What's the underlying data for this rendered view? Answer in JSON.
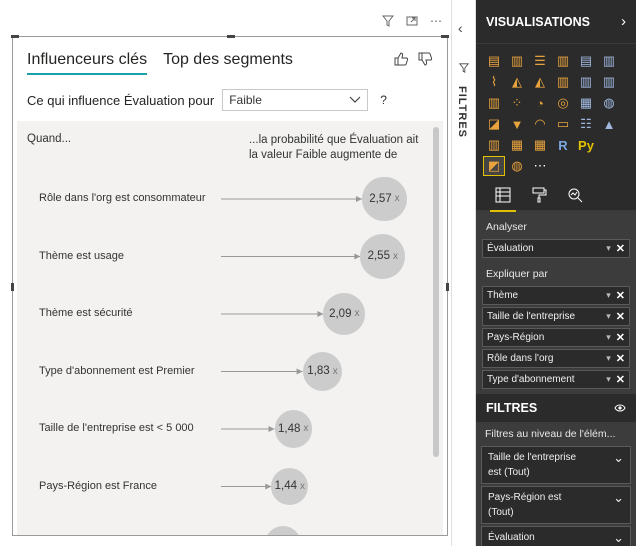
{
  "canvas": {
    "header_icons": [
      "filter-icon",
      "focus-mode-icon",
      "more-options-icon"
    ]
  },
  "visual": {
    "tabs": [
      {
        "label": "Influenceurs clés",
        "active": true
      },
      {
        "label": "Top des segments",
        "active": false
      }
    ],
    "influence_label": "Ce qui influence Évaluation pour",
    "influence_value": "Faible",
    "help": "?",
    "col_left": "Quand...",
    "col_right": "...la probabilité que Évaluation ait la valeur Faible augmente de",
    "accent_color": "#1aa0a6",
    "influencers": [
      {
        "label": "Rôle dans l'org est consommateur",
        "value": "2,57",
        "unit": "x",
        "factor": 2.57
      },
      {
        "label": "Thème est usage",
        "value": "2,55",
        "unit": "x",
        "factor": 2.55
      },
      {
        "label": "Thème est sécurité",
        "value": "2,09",
        "unit": "x",
        "factor": 2.09
      },
      {
        "label": "Type d'abonnement est Premier",
        "value": "1,83",
        "unit": "x",
        "factor": 1.83
      },
      {
        "label": "Taille de l'entreprise est < 5 000",
        "value": "1,48",
        "unit": "x",
        "factor": 1.48
      },
      {
        "label": "Pays-Région est France",
        "value": "1,44",
        "unit": "x",
        "factor": 1.44
      },
      {
        "label": "",
        "value": "",
        "unit": "",
        "factor": 1.36
      }
    ]
  },
  "filters_rail": {
    "label": "FILTRES"
  },
  "vis_pane": {
    "title": "VISUALISATIONS",
    "gallery_icons": [
      "stacked-bar-icon",
      "stacked-column-icon",
      "clustered-bar-icon",
      "clustered-column-icon",
      "100-bar-icon",
      "100-column-icon",
      "line-chart-icon",
      "area-chart-icon",
      "stacked-area-icon",
      "line-column-icon",
      "line-clustered-column-icon",
      "ribbon-chart-icon",
      "waterfall-icon",
      "scatter-icon",
      "pie-chart-icon",
      "donut-chart-icon",
      "treemap-icon",
      "map-icon",
      "filled-map-icon",
      "funnel-icon",
      "gauge-icon",
      "card-icon",
      "multirow-card-icon",
      "kpi-icon",
      "slicer-icon",
      "table-icon",
      "matrix-icon",
      "r-visual-icon",
      "python-visual-icon",
      "",
      "key-influencers-icon",
      "globe-icon",
      "more-visuals-icon"
    ],
    "gallery_glyphs": [
      "▤",
      "▥",
      "☰",
      "▥",
      "▤",
      "▥",
      "⌇",
      "◭",
      "◭",
      "▥",
      "▥",
      "▥",
      "▥",
      "⁘",
      "◔",
      "◎",
      "▦",
      "◍",
      "◪",
      "▼",
      "◠",
      "▭",
      "☷",
      "▲",
      "▥",
      "▦",
      "▦",
      "R",
      "Py",
      "",
      "◩",
      "◍",
      "⋯"
    ],
    "tools": [
      "fields-icon",
      "format-paint-icon",
      "analytics-icon"
    ],
    "analyser_label": "Analyser",
    "analyser_fields": [
      "Évaluation"
    ],
    "explain_label": "Expliquer par",
    "explain_fields": [
      "Thème",
      "Taille de l'entreprise",
      "Pays-Région",
      "Rôle dans l'org",
      "Type d'abonnement"
    ],
    "filters_title": "FILTRES",
    "filters_visual_label": "Filtres au niveau de l'élém...",
    "filter_cards": [
      "Taille de l'entreprise est (Tout)",
      "Pays-Région est (Tout)",
      "Évaluation"
    ],
    "selected_color": "#e2c200"
  }
}
